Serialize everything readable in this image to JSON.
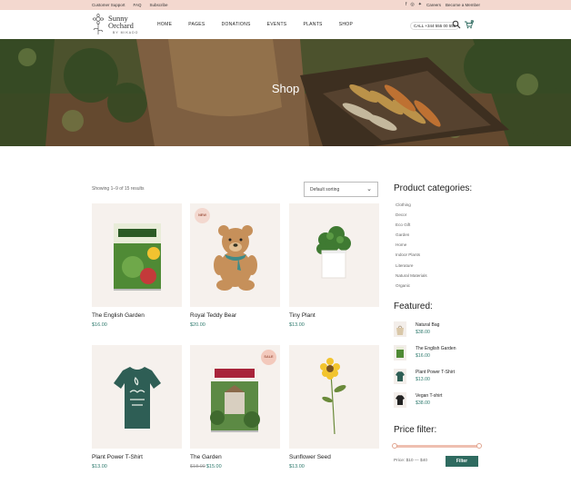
{
  "topbar": {
    "links": [
      "Customer Support",
      "FAQ",
      "Subscribe"
    ],
    "right_links": [
      "Careers",
      "Become a Member"
    ],
    "social_icons": [
      "facebook-icon",
      "instagram-icon",
      "twitter-icon"
    ]
  },
  "header": {
    "logo": {
      "line1": "Sunny",
      "line2": "Orchard",
      "tagline": "BY MIKADO"
    },
    "nav": [
      "HOME",
      "PAGES",
      "DONATIONS",
      "EVENTS",
      "PLANTS",
      "SHOP"
    ],
    "call": "CALL +344 555 00 555",
    "icons": [
      "search-icon",
      "cart-icon"
    ],
    "cart_count": "0"
  },
  "hero": {
    "title": "Shop"
  },
  "shop": {
    "result_count": "Showing 1–9 of 15 results",
    "sort_selected": "Default sorting"
  },
  "products": [
    {
      "name": "The English Garden",
      "price": "$16.00"
    },
    {
      "name": "Royal Teddy Bear",
      "price": "$20.00",
      "badge": "NEW"
    },
    {
      "name": "Tiny Plant",
      "price": "$13.00"
    },
    {
      "name": "Plant Power T-Shirt",
      "price": "$13.00"
    },
    {
      "name": "The Garden",
      "old_price": "$18.00",
      "price": "$15.00",
      "badge": "SALE"
    },
    {
      "name": "Sunflower Seed",
      "price": "$13.00"
    }
  ],
  "sidebar": {
    "categories_title": "Product categories:",
    "categories": [
      "Clothing",
      "Decor",
      "Eco Gift",
      "Garden",
      "Home",
      "Indoor Plants",
      "Literature",
      "Natural Materials",
      "Organic"
    ],
    "featured_title": "Featured:",
    "featured": [
      {
        "name": "Natural Bag",
        "price": "$38.00"
      },
      {
        "name": "The English Garden",
        "price": "$16.00"
      },
      {
        "name": "Plant Power T-Shirt",
        "price": "$13.00"
      },
      {
        "name": "Vegan T-shirt",
        "price": "$38.00"
      }
    ],
    "price_filter_title": "Price filter:",
    "price_range": "Price: $10 — $40",
    "filter_button": "Filter"
  },
  "colors": {
    "accent": "#2f6b60",
    "price": "#2f7a6e",
    "topbar": "#f3d8cf",
    "badge": "#f3d8cf"
  }
}
